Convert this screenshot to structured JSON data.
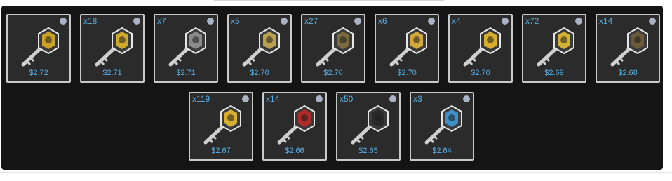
{
  "tiles_row1": [
    {
      "qty": "",
      "price": "$2.72",
      "emblem": "#c9a227",
      "icon": "case-key-icon"
    },
    {
      "qty": "x18",
      "price": "$2.71",
      "emblem": "#cfa92a",
      "icon": "case-key-icon"
    },
    {
      "qty": "x7",
      "price": "$2.71",
      "emblem": "#8a8a8a",
      "icon": "case-key-icon"
    },
    {
      "qty": "x5",
      "price": "$2.70",
      "emblem": "#b8a050",
      "icon": "case-key-icon"
    },
    {
      "qty": "x27",
      "price": "$2.70",
      "emblem": "#7a6a40",
      "icon": "case-key-icon"
    },
    {
      "qty": "x6",
      "price": "$2.70",
      "emblem": "#d1a93a",
      "icon": "case-key-icon"
    },
    {
      "qty": "x4",
      "price": "$2.70",
      "emblem": "#d6ae2e",
      "icon": "case-key-icon"
    },
    {
      "qty": "x72",
      "price": "$2.69",
      "emblem": "#d4b034",
      "icon": "case-key-icon"
    },
    {
      "qty": "x14",
      "price": "$2.68",
      "emblem": "#6a5a3a",
      "icon": "case-key-icon"
    }
  ],
  "tiles_row2": [
    {
      "qty": "x119",
      "price": "$2.67",
      "emblem": "#d8ae30",
      "icon": "case-key-icon"
    },
    {
      "qty": "x14",
      "price": "$2.66",
      "emblem": "#b02a2a",
      "icon": "case-key-icon"
    },
    {
      "qty": "x50",
      "price": "$2.65",
      "emblem": "#2a2a2a",
      "icon": "case-key-icon"
    },
    {
      "qty": "x3",
      "price": "$2.64",
      "emblem": "#3f8fc9",
      "icon": "case-key-icon"
    }
  ]
}
